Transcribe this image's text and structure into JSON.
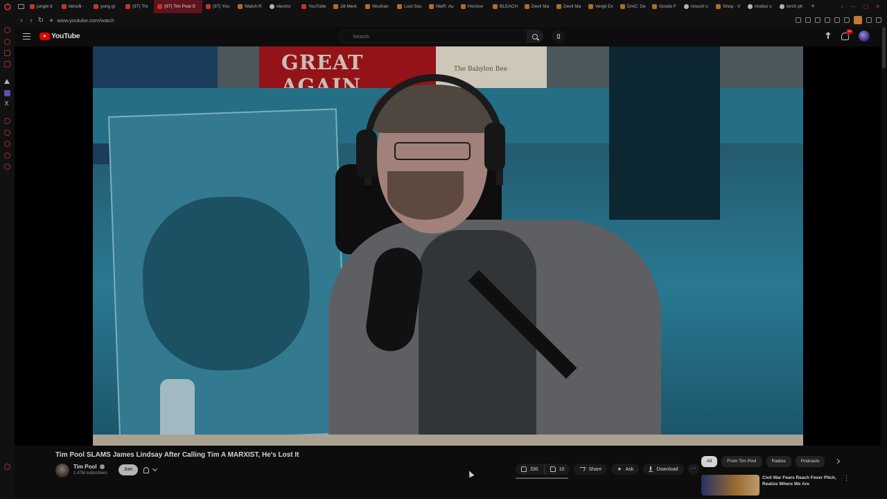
{
  "browser": {
    "tabs": [
      {
        "label": "jungle b",
        "icon": "youtube-icon",
        "active": false
      },
      {
        "label": "bbno$ -",
        "icon": "youtube-icon",
        "active": false
      },
      {
        "label": "yung gr",
        "icon": "youtube-icon",
        "active": false
      },
      {
        "label": "(97) Thi",
        "icon": "youtube-icon",
        "active": false
      },
      {
        "label": "(97) Tim Pool S",
        "icon": "youtube-icon",
        "active": true
      },
      {
        "label": "(97) You",
        "icon": "youtube-icon",
        "active": false
      },
      {
        "label": "Watch R",
        "icon": "site-icon",
        "active": false
      },
      {
        "label": "electric",
        "icon": "globe-icon",
        "active": false
      },
      {
        "label": "YouTube",
        "icon": "youtube-icon",
        "active": false
      },
      {
        "label": "Jill Merk",
        "icon": "site-icon",
        "active": false
      },
      {
        "label": "Wuchan",
        "icon": "site-icon",
        "active": false
      },
      {
        "label": "Lost Sou",
        "icon": "site-icon",
        "active": false
      },
      {
        "label": "NieR: Au",
        "icon": "site-icon",
        "active": false
      },
      {
        "label": "Horizon",
        "icon": "site-icon",
        "active": false
      },
      {
        "label": "BLEACH",
        "icon": "site-icon",
        "active": false
      },
      {
        "label": "Devil Ma",
        "icon": "site-icon",
        "active": false
      },
      {
        "label": "Devil Ma",
        "icon": "site-icon",
        "active": false
      },
      {
        "label": "Vergil Ex",
        "icon": "site-icon",
        "active": false
      },
      {
        "label": "DmC: De",
        "icon": "site-icon",
        "active": false
      },
      {
        "label": "Goods F",
        "icon": "site-icon",
        "active": false
      },
      {
        "label": "resuzit o",
        "icon": "globe-icon",
        "active": false
      },
      {
        "label": "Shop - V",
        "icon": "site-icon",
        "active": false
      },
      {
        "label": "modus s",
        "icon": "globe-icon",
        "active": false
      },
      {
        "label": "torch ph",
        "icon": "globe-icon",
        "active": false
      }
    ],
    "url": "www.youtube.com/watch"
  },
  "youtube": {
    "logo_text": "YouTube",
    "search_placeholder": "Search",
    "notification_count": "9+",
    "video": {
      "title": "Tim Pool SLAMS James Lindsay After Calling Tim A MARXIST, He's Lost It",
      "channel": "Tim Pool",
      "subscribers": "1.47M subscribers",
      "join_label": "Join",
      "likes": "330",
      "dislikes": "10",
      "share_label": "Share",
      "ask_label": "Ask",
      "download_label": "Download",
      "scene_sign_text": "GREAT AGAIN",
      "scene_book_text": "The Babylon Bee"
    },
    "chips": [
      "All",
      "From Tim Pool",
      "Radios",
      "Podcasts"
    ],
    "recommendation": {
      "title": "Civil War Fears Reach Fever Pitch, Realize Where We Are"
    }
  },
  "colors": {
    "accent": "#ff0000",
    "active_tab": "#6b1620",
    "background": "#0f0f0f"
  }
}
